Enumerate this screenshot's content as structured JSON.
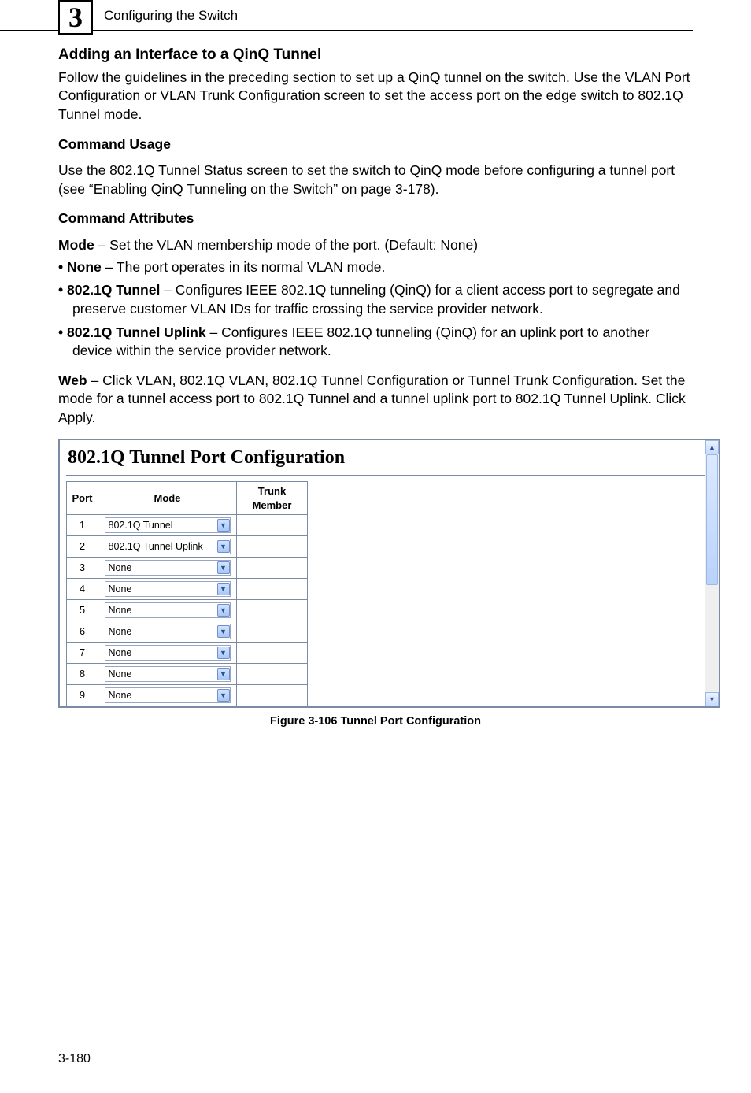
{
  "header": {
    "chapter_number": "3",
    "running_title": "Configuring the Switch"
  },
  "section": {
    "title": "Adding an Interface to a QinQ Tunnel",
    "intro": "Follow the guidelines in the preceding section to set up a QinQ tunnel on the switch. Use the VLAN Port Configuration or VLAN Trunk Configuration screen to set the access port on the edge switch to 802.1Q Tunnel mode.",
    "command_usage_heading": "Command Usage",
    "command_usage_text": "Use the 802.1Q Tunnel Status screen to set the switch to QinQ mode before configuring a tunnel port (see “Enabling QinQ Tunneling on the Switch” on page 3-178).",
    "command_attributes_heading": "Command Attributes",
    "mode_lead_bold": "Mode",
    "mode_lead_rest": " – Set the VLAN membership mode of the port. (Default: None)",
    "bullets": [
      {
        "bold": "None",
        "rest": " – The port operates in its normal VLAN mode."
      },
      {
        "bold": "802.1Q Tunnel",
        "rest": " – Configures IEEE 802.1Q tunneling (QinQ) for a client access port to segregate and preserve customer VLAN IDs for traffic crossing the service provider network."
      },
      {
        "bold": "802.1Q Tunnel Uplink",
        "rest": " – Configures IEEE 802.1Q tunneling (QinQ) for an uplink port to another device within the service provider network."
      }
    ],
    "web_lead_bold": "Web",
    "web_lead_rest": " – Click VLAN, 802.1Q VLAN, 802.1Q Tunnel Configuration or Tunnel Trunk Configuration. Set the mode for a tunnel access port to 802.1Q Tunnel and a tunnel uplink port to 802.1Q Tunnel Uplink. Click Apply."
  },
  "screenshot": {
    "title": "802.1Q Tunnel Port Configuration",
    "columns": {
      "port": "Port",
      "mode": "Mode",
      "trunk": "Trunk Member"
    },
    "rows": [
      {
        "port": "1",
        "mode": "802.1Q Tunnel",
        "trunk": ""
      },
      {
        "port": "2",
        "mode": "802.1Q Tunnel Uplink",
        "trunk": ""
      },
      {
        "port": "3",
        "mode": "None",
        "trunk": ""
      },
      {
        "port": "4",
        "mode": "None",
        "trunk": ""
      },
      {
        "port": "5",
        "mode": "None",
        "trunk": ""
      },
      {
        "port": "6",
        "mode": "None",
        "trunk": ""
      },
      {
        "port": "7",
        "mode": "None",
        "trunk": ""
      },
      {
        "port": "8",
        "mode": "None",
        "trunk": ""
      },
      {
        "port": "9",
        "mode": "None",
        "trunk": ""
      }
    ],
    "caption": "Figure 3-106  Tunnel Port Configuration"
  },
  "footer": {
    "page_number": "3-180"
  },
  "icons": {
    "chevron_down": "▼",
    "chevron_up": "▲"
  }
}
